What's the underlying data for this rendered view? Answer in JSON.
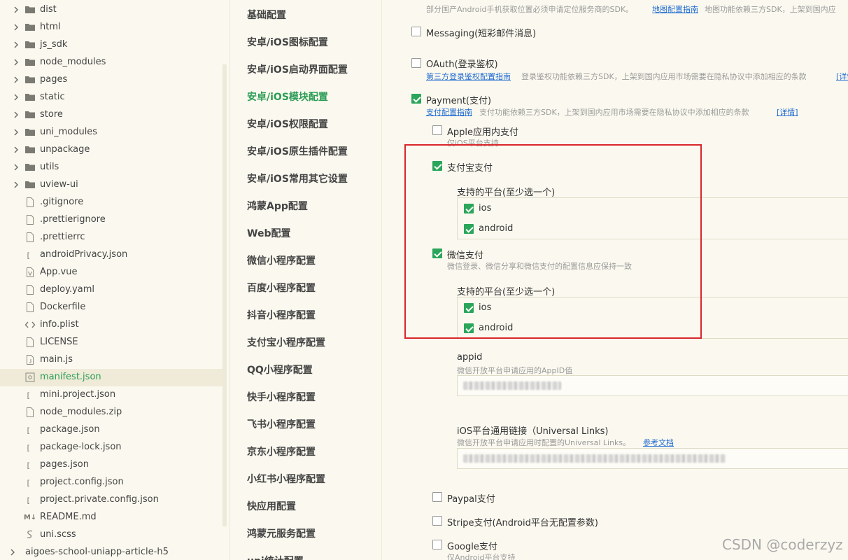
{
  "file_tree": {
    "items": [
      {
        "label": "dist",
        "type": "folder"
      },
      {
        "label": "html",
        "type": "folder"
      },
      {
        "label": "js_sdk",
        "type": "folder"
      },
      {
        "label": "node_modules",
        "type": "folder"
      },
      {
        "label": "pages",
        "type": "folder"
      },
      {
        "label": "static",
        "type": "folder"
      },
      {
        "label": "store",
        "type": "folder"
      },
      {
        "label": "uni_modules",
        "type": "folder"
      },
      {
        "label": "unpackage",
        "type": "folder"
      },
      {
        "label": "utils",
        "type": "folder"
      },
      {
        "label": "uview-ui",
        "type": "folder"
      },
      {
        "label": ".gitignore",
        "type": "file"
      },
      {
        "label": ".prettierignore",
        "type": "file"
      },
      {
        "label": ".prettierrc",
        "type": "file"
      },
      {
        "label": "androidPrivacy.json",
        "type": "json"
      },
      {
        "label": "App.vue",
        "type": "vue"
      },
      {
        "label": "deploy.yaml",
        "type": "file"
      },
      {
        "label": "Dockerfile",
        "type": "file"
      },
      {
        "label": "info.plist",
        "type": "code"
      },
      {
        "label": "LICENSE",
        "type": "file"
      },
      {
        "label": "main.js",
        "type": "js"
      },
      {
        "label": "manifest.json",
        "type": "manifest",
        "active": true
      },
      {
        "label": "mini.project.json",
        "type": "json"
      },
      {
        "label": "node_modules.zip",
        "type": "file"
      },
      {
        "label": "package.json",
        "type": "json"
      },
      {
        "label": "package-lock.json",
        "type": "json"
      },
      {
        "label": "pages.json",
        "type": "json"
      },
      {
        "label": "project.config.json",
        "type": "json"
      },
      {
        "label": "project.private.config.json",
        "type": "json"
      },
      {
        "label": "README.md",
        "type": "md"
      },
      {
        "label": "uni.scss",
        "type": "scss"
      },
      {
        "label": "aigoes-school-uniapp-article-h5",
        "type": "root"
      }
    ],
    "md_icon_text": "M↓"
  },
  "config_nav": {
    "items": [
      {
        "label": "基础配置"
      },
      {
        "label": "安卓/iOS图标配置"
      },
      {
        "label": "安卓/iOS启动界面配置"
      },
      {
        "label": "安卓/iOS模块配置",
        "active": true
      },
      {
        "label": "安卓/iOS权限配置"
      },
      {
        "label": "安卓/iOS原生插件配置"
      },
      {
        "label": "安卓/iOS常用其它设置"
      },
      {
        "label": "鸿蒙App配置"
      },
      {
        "label": "Web配置"
      },
      {
        "label": "微信小程序配置"
      },
      {
        "label": "百度小程序配置"
      },
      {
        "label": "抖音小程序配置"
      },
      {
        "label": "支付宝小程序配置"
      },
      {
        "label": "QQ小程序配置"
      },
      {
        "label": "快手小程序配置"
      },
      {
        "label": "飞书小程序配置"
      },
      {
        "label": "京东小程序配置"
      },
      {
        "label": "小红书小程序配置"
      },
      {
        "label": "快应用配置"
      },
      {
        "label": "鸿蒙元服务配置"
      },
      {
        "label": "uni统计配置"
      }
    ]
  },
  "main": {
    "top_hint": "部分国产Android手机获取位置必须申请定位服务商的SDK。",
    "top_link": "地图配置指南",
    "top_hint_after": "地图功能依赖三方SDK，上架到国内应",
    "messaging": {
      "label": "Messaging(短彩邮件消息)",
      "checked": false
    },
    "oauth": {
      "label": "OAuth(登录鉴权)",
      "checked": false,
      "link": "第三方登录鉴权配置指南",
      "hint": "登录鉴权功能依赖三方SDK，上架到国内应用市场需要在隐私协议中添加相应的条款",
      "hint_link": "[详情"
    },
    "payment": {
      "label": "Payment(支付)",
      "checked": true,
      "link": "支付配置指南",
      "hint": "支付功能依赖三方SDK，上架到国内应用市场需要在隐私协议中添加相应的条款",
      "hint_link": "[详情]"
    },
    "apple_pay": {
      "label": "Apple应用内支付",
      "checked": false,
      "hint": "仅iOS平台支持"
    },
    "alipay": {
      "label": "支付宝支付",
      "checked": true,
      "platforms_title": "支持的平台(至少选一个)",
      "platforms": [
        {
          "label": "ios",
          "checked": true
        },
        {
          "label": "android",
          "checked": true
        }
      ]
    },
    "wechat_pay": {
      "label": "微信支付",
      "checked": true,
      "hint": "微信登录、微信分享和微信支付的配置信息应保持一致",
      "platforms_title": "支持的平台(至少选一个)",
      "platforms": [
        {
          "label": "ios",
          "checked": true
        },
        {
          "label": "android",
          "checked": true
        }
      ]
    },
    "appid": {
      "label": "appid",
      "hint": "微信开放平台申请应用的AppID值",
      "value": ""
    },
    "universal_links": {
      "label": "iOS平台通用链接（Universal Links)",
      "hint": "微信开放平台申请应用时配置的Universal Links。",
      "hint_link": "参考文档",
      "value": ""
    },
    "paypal": {
      "label": "Paypal支付",
      "checked": false
    },
    "stripe": {
      "label": "Stripe支付(Android平台无配置参数)",
      "checked": false
    },
    "google_pay": {
      "label": "Google支付",
      "checked": false,
      "hint": "仅Android平台支持"
    }
  },
  "watermark": "CSDN @coderzyz",
  "colors": {
    "accent": "#2aa55a",
    "link": "#1f6ad0",
    "highlight": "#d9262b",
    "background": "#fbf9ef"
  }
}
